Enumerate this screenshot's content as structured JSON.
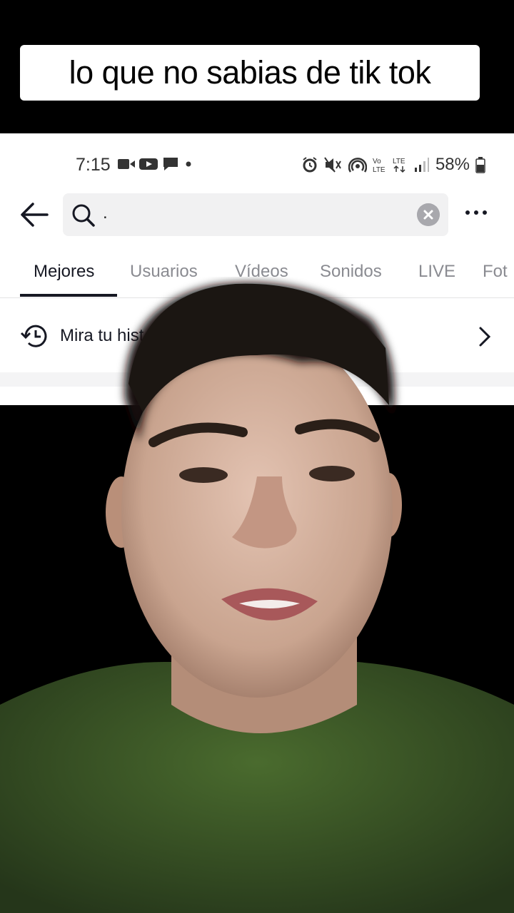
{
  "caption": {
    "text": "lo que no sabias de tik tok"
  },
  "status_bar": {
    "time": "7:15",
    "left_icons": [
      "video-camera-icon",
      "youtube-icon",
      "chat-icon",
      "dot-icon"
    ],
    "right_icons": [
      "alarm-icon",
      "mute-icon",
      "hotspot-icon",
      "volte-icon",
      "lte-icon",
      "signal-icon"
    ],
    "battery": "58%"
  },
  "search": {
    "value": "."
  },
  "tabs": [
    {
      "label": "Mejores",
      "active": true
    },
    {
      "label": "Usuarios",
      "active": false
    },
    {
      "label": "Vídeos",
      "active": false
    },
    {
      "label": "Sonidos",
      "active": false
    },
    {
      "label": "LIVE",
      "active": false
    },
    {
      "label": "Fot",
      "active": false
    }
  ],
  "history": {
    "label": "Mira tu hist"
  },
  "colors": {
    "shirt": "#3d5a26",
    "skin": "#c9a48f",
    "hair": "#15110e",
    "text_dark": "#161823",
    "text_muted": "#8a8b91"
  }
}
